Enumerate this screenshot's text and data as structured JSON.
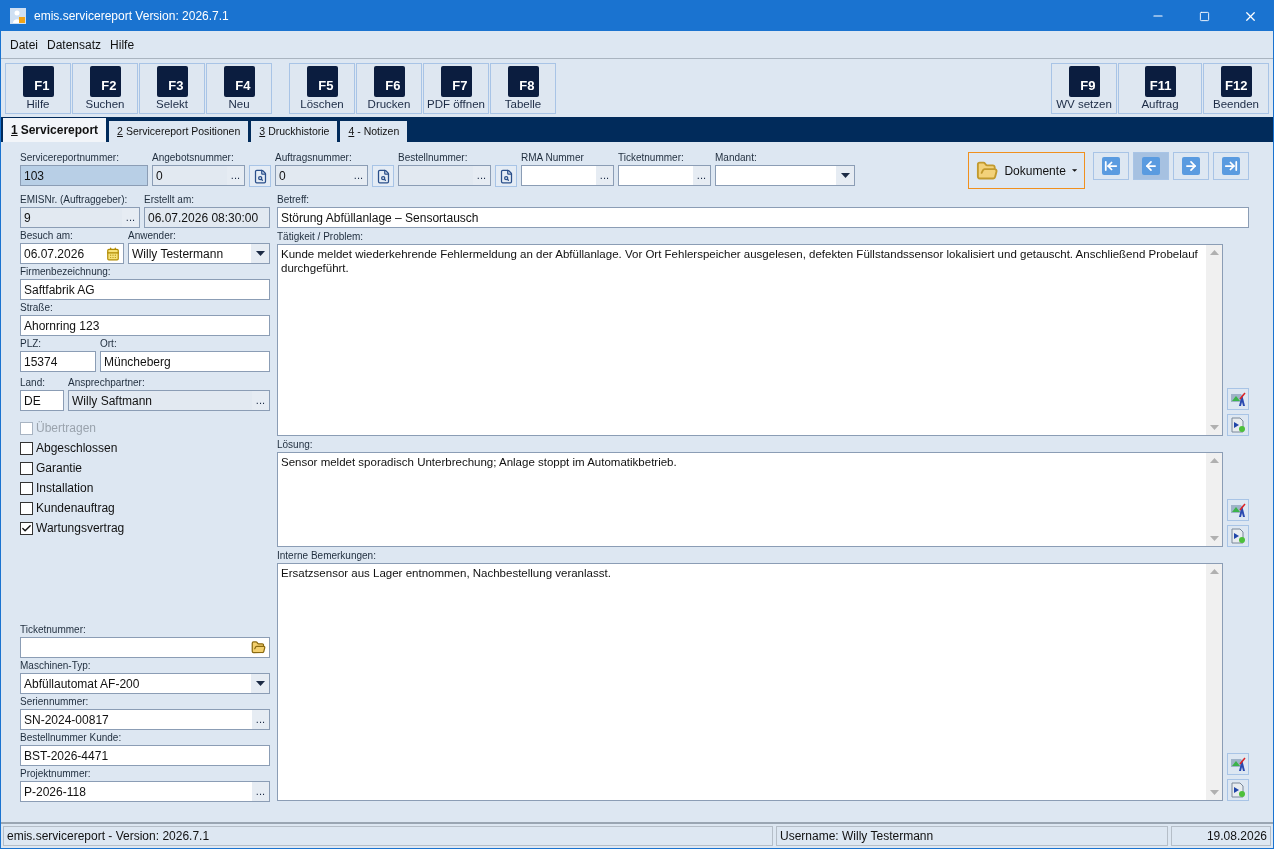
{
  "window": {
    "title": "emis.servicereport Version: 2026.7.1"
  },
  "menu": [
    {
      "label": "Datei"
    },
    {
      "label": "Datensatz"
    },
    {
      "label": "Hilfe"
    }
  ],
  "toolbar": {
    "left": [
      {
        "key": "F1",
        "label": "Hilfe"
      },
      {
        "key": "F2",
        "label": "Suchen"
      },
      {
        "key": "F3",
        "label": "Selekt"
      },
      {
        "key": "F4",
        "label": "Neu"
      }
    ],
    "middle": [
      {
        "key": "F5",
        "label": "Löschen"
      },
      {
        "key": "F6",
        "label": "Drucken"
      },
      {
        "key": "F7",
        "label": "PDF öffnen"
      },
      {
        "key": "F8",
        "label": "Tabelle"
      }
    ],
    "right": [
      {
        "key": "F9",
        "label": "WV setzen"
      },
      {
        "key": "F11",
        "label": "Auftrag"
      },
      {
        "key": "F12",
        "label": "Beenden"
      }
    ]
  },
  "tabs": [
    {
      "key": "1",
      "label": "Servicereport",
      "selected": true
    },
    {
      "key": "2",
      "label": "Servicereport Positionen",
      "selected": false
    },
    {
      "key": "3",
      "label": "Druckhistorie",
      "selected": false
    },
    {
      "key": "4",
      "label": "- Notizen",
      "selected": false
    }
  ],
  "header_fields": [
    {
      "label": "Servicereportnummer:",
      "value": "103",
      "kind": "text",
      "focused": true
    },
    {
      "label": "Angebotsnummer:",
      "value": "0",
      "kind": "lookup",
      "button": "...",
      "readonly": true,
      "search": true
    },
    {
      "label": "Auftragsnummer:",
      "value": "0",
      "kind": "lookup",
      "button": "...",
      "readonly": true,
      "search": true
    },
    {
      "label": "Bestellnummer:",
      "kind": "lookup",
      "button": "...",
      "readonly": true,
      "search": true
    },
    {
      "label": "RMA Nummer",
      "kind": "lookup",
      "button": "...",
      "readonly": false
    },
    {
      "label": "Ticketnummer:",
      "kind": "lookup",
      "button": "...",
      "readonly": false
    },
    {
      "label": "Mandant:",
      "kind": "combo",
      "readonly": false
    }
  ],
  "documents_button": {
    "label": "Dokumente"
  },
  "record_nav": [
    {
      "kind": "first",
      "pressed": false
    },
    {
      "kind": "previous",
      "pressed": true
    },
    {
      "kind": "next",
      "pressed": false
    },
    {
      "kind": "last",
      "pressed": false
    }
  ],
  "customer_rows": [
    {
      "fields": [
        {
          "label": "EMISNr. (Auftraggeber):",
          "value": "9",
          "kind": "lookup",
          "button": "...",
          "readonly": true
        },
        {
          "label": "Erstellt am:",
          "value": "06.07.2026 08:30:00",
          "kind": "text",
          "readonly": true
        }
      ]
    },
    {
      "fields": [
        {
          "label": "Besuch am:",
          "value": "06.07.2026",
          "kind": "date",
          "readonly": false
        },
        {
          "label": "Anwender:",
          "value": "Willy Testermann",
          "kind": "combo",
          "readonly": false
        }
      ]
    },
    {
      "fields": [
        {
          "label": "Firmenbezeichnung:",
          "value": "Saftfabrik AG",
          "kind": "text",
          "readonly": false
        }
      ]
    },
    {
      "fields": [
        {
          "label": "Straße:",
          "value": "Ahornring 123",
          "kind": "text",
          "readonly": false
        }
      ]
    },
    {
      "fields": [
        {
          "label": "PLZ:",
          "value": "15374",
          "kind": "text",
          "readonly": false
        },
        {
          "label": "Ort:",
          "value": "Müncheberg",
          "kind": "text",
          "readonly": false
        }
      ]
    },
    {
      "fields": [
        {
          "label": "Land:",
          "value": "DE",
          "kind": "text",
          "readonly": false
        },
        {
          "label": "Ansprechpartner:",
          "value": "Willy Saftmann",
          "kind": "lookup",
          "button": "...",
          "readonly": true
        }
      ]
    }
  ],
  "checkboxes": [
    {
      "label": "Übertragen",
      "checked": false,
      "disabled": true
    },
    {
      "label": "Abgeschlossen",
      "checked": false,
      "disabled": false
    },
    {
      "label": "Garantie",
      "checked": false,
      "disabled": false
    },
    {
      "label": "Installation",
      "checked": false,
      "disabled": false
    },
    {
      "label": "Kundenauftrag",
      "checked": false,
      "disabled": false
    },
    {
      "label": "Wartungsvertrag",
      "checked": true,
      "disabled": false
    }
  ],
  "machine_fields": [
    {
      "label": "Ticketnummer:",
      "kind": "file",
      "readonly": false
    },
    {
      "label": "Maschinen-Typ:",
      "value": "Abfüllautomat AF-200",
      "kind": "combo",
      "readonly": false
    },
    {
      "label": "Seriennummer:",
      "value": "SN-2024-00817",
      "kind": "lookup",
      "button": "...",
      "readonly": false
    },
    {
      "label": "Bestellnummer Kunde:",
      "value": "BST-2026-4471",
      "kind": "text",
      "readonly": false
    },
    {
      "label": "Projektnummer:",
      "value": "P-2026-118",
      "kind": "lookup",
      "button": "...",
      "readonly": false
    }
  ],
  "subject": {
    "label": "Betreff:",
    "value": "Störung Abfüllanlage – Sensortausch"
  },
  "text_areas": [
    {
      "label": "Tätigkeit / Problem:",
      "value": "Kunde meldet wiederkehrende Fehlermeldung an der Abfüllanlage. Vor Ort Fehlerspeicher ausgelesen, defekten Füllstandssensor lokalisiert und getauscht. Anschließend Probelauf durchgeführt."
    },
    {
      "label": "Lösung:",
      "value": "Sensor meldet sporadisch Unterbrechung; Anlage stoppt im Automatikbetrieb."
    },
    {
      "label": "Interne Bemerkungen:",
      "value": "Ersatzsensor aus Lager entnommen, Nachbestellung veranlasst."
    }
  ],
  "status_bar": [
    "emis.servicereport - Version: 2026.7.1",
    "Username: Willy Testermann",
    "19.08.2026"
  ]
}
